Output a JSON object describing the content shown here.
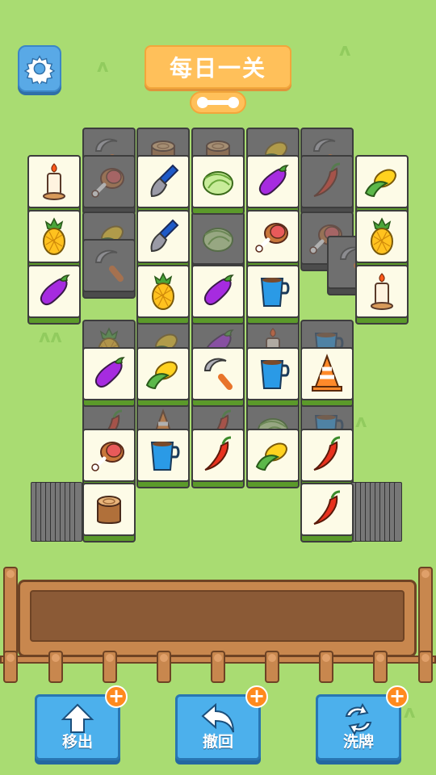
{
  "header": {
    "title": "每日一关",
    "settings_icon": "gear-icon",
    "progress_icon": "progress-bar-icon"
  },
  "board": {
    "tiles_top": [
      {
        "icon": "candle",
        "state": "open"
      },
      {
        "icon": "shovel",
        "state": "open"
      },
      {
        "icon": "cabbage",
        "state": "open"
      },
      {
        "icon": "eggplant",
        "state": "open"
      },
      {
        "icon": "corn",
        "state": "open"
      },
      {
        "icon": "pineapple",
        "state": "open"
      },
      {
        "icon": "shovel",
        "state": "open"
      },
      {
        "icon": "ham",
        "state": "open"
      },
      {
        "icon": "pineapple",
        "state": "open"
      },
      {
        "icon": "eggplant",
        "state": "open"
      },
      {
        "icon": "pineapple",
        "state": "open"
      },
      {
        "icon": "eggplant",
        "state": "open"
      },
      {
        "icon": "cup",
        "state": "open"
      },
      {
        "icon": "candle",
        "state": "open"
      },
      {
        "icon": "eggplant",
        "state": "open"
      },
      {
        "icon": "corn",
        "state": "open"
      },
      {
        "icon": "sickle",
        "state": "open"
      },
      {
        "icon": "cup",
        "state": "open"
      },
      {
        "icon": "cone",
        "state": "open"
      },
      {
        "icon": "ham",
        "state": "open"
      },
      {
        "icon": "cup",
        "state": "open"
      },
      {
        "icon": "chili",
        "state": "open"
      },
      {
        "icon": "corn",
        "state": "open"
      },
      {
        "icon": "chili",
        "state": "open"
      },
      {
        "icon": "stump",
        "state": "open"
      },
      {
        "icon": "chili",
        "state": "open"
      }
    ]
  },
  "toolbar": {
    "move_out_label": "移出",
    "undo_label": "撤回",
    "shuffle_label": "洗牌",
    "plus_label": "+"
  },
  "colors": {
    "background": "#a9dc72",
    "button_blue": "#4cb0ec",
    "banner_orange": "#ffc05a",
    "tile_face": "#fdfbe7",
    "tile_base": "#5b9a2a"
  }
}
